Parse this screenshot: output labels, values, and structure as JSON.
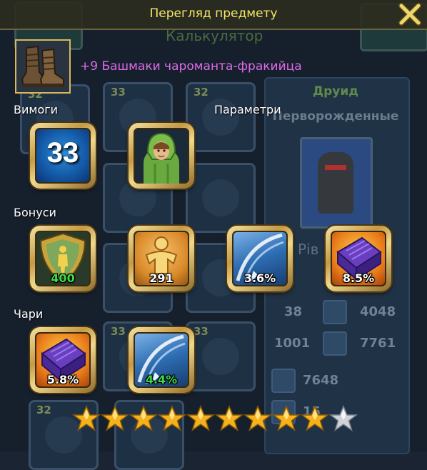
{
  "window": {
    "title": "Перегляд предмету",
    "background_title": "Калькулятор"
  },
  "item": {
    "name": "+9 Башмаки чароманта-фракийца",
    "icon": "leather-boots-icon",
    "name_color": "#e06ae8"
  },
  "requirements": {
    "label": "Вимоги",
    "level": "33",
    "class_icon": "druid-portrait-icon"
  },
  "parameters": {
    "label": "Параметри"
  },
  "bonuses": {
    "label": "Бонуси",
    "items": [
      {
        "icon": "shield-defense-icon",
        "value": "400",
        "highlight": true
      },
      {
        "icon": "body-stamina-icon",
        "value": "291",
        "highlight": false
      },
      {
        "icon": "sword-slash-icon",
        "value": "3.6%",
        "highlight": false
      },
      {
        "icon": "magic-book-icon",
        "value": "8.5%",
        "highlight": false
      }
    ]
  },
  "enchants": {
    "label": "Чари",
    "items": [
      {
        "icon": "magic-book-icon",
        "value": "5.8%",
        "highlight": false
      },
      {
        "icon": "sword-slash-icon",
        "value": "4.4%",
        "highlight": true
      }
    ]
  },
  "stars": {
    "filled": 9,
    "total": 10
  },
  "background": {
    "class_name": "Друид",
    "race": "Перворожденные",
    "riv_text": "Рів",
    "stats": [
      "38",
      "4048",
      "1001",
      "7761",
      "7648",
      "15"
    ],
    "slot_levels": [
      "32",
      "33",
      "32",
      "32",
      "33",
      "33",
      "32"
    ]
  },
  "colors": {
    "title_text": "#f3e76a",
    "gold_frame": "#d7b75a",
    "green_value": "#3ed94a"
  }
}
